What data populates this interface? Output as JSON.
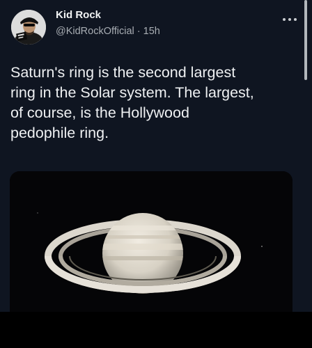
{
  "tweet": {
    "author_name": "Kid Rock",
    "handle_and_time": "@KidRockOfficial · 15h",
    "text": "Saturn's ring is the second largest\nring in the Solar system. The largest,\nof course, is the Hollywood\npedophile ring.",
    "more_icon": "ellipsis-icon",
    "media_subject": "saturn-image"
  }
}
